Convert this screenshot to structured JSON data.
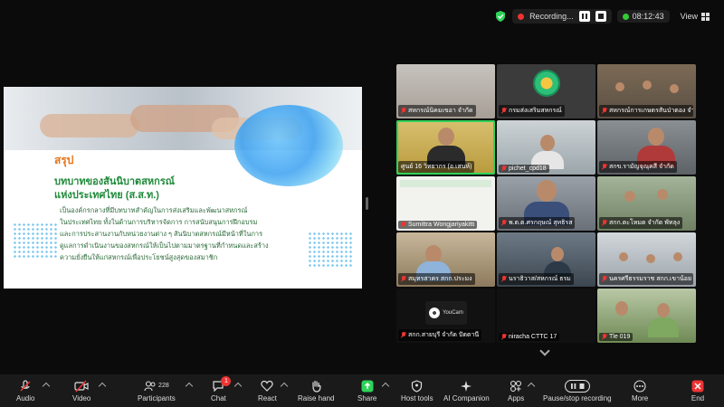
{
  "topbar": {
    "recording_label": "Recording...",
    "time": "08:12:43",
    "view_label": "View"
  },
  "slide": {
    "heading": "สรุป",
    "subtitle_line1": "บทบาทของสันนิบาตสหกรณ์",
    "subtitle_line2": "แห่งประเทศไทย (ส.ส.ท.)",
    "body_lines": [
      "เป็นองค์กรกลางที่มีบทบาทสำคัญในการส่งเสริมและพัฒนาสหกรณ์",
      "ในประเทศไทย ทั้งในด้านการบริหารจัดการ การสนับสนุนการฝึกอบรม",
      "และการประสานงานกับหน่วยงานต่าง ๆ สันนิบาตสหกรณ์มีหน้าที่ในการ",
      "ดูแลการดำเนินงานของสหกรณ์ให้เป็นไปตามมาตรฐานที่กำหนดและสร้าง",
      "ความยั่งยืนให้แก่สหกรณ์เพื่อประโยชน์สูงสุดของสมาชิก"
    ]
  },
  "participants_tiles": [
    {
      "name": "สหกรณ์นิคมเขอา จำกัด"
    },
    {
      "name": "กรมส่งเสริมสหกรณ์"
    },
    {
      "name": "สหกรณ์การเกษตรสันป่าตอง จำก"
    },
    {
      "name": "ศูนย์ 16 วิทยากร (อ.เสนห์)"
    },
    {
      "name": "pichet_cpd18"
    },
    {
      "name": "สกข.รามัญจุณุคสี จำกัด"
    },
    {
      "name": "Sumittra Wongjariyakitti"
    },
    {
      "name": "พ.ต.ต.ศรกฤษณ์ สุทธิรส"
    },
    {
      "name": "สกก.ตะโหมด จำกัด พัทลุง"
    },
    {
      "name": "สมุทรสาคร สกก.ประมง"
    },
    {
      "name": "นราธิวาส/สหกรณ์ ธรม"
    },
    {
      "name": "นครศรีธรรมราช สกก.เขาน้อย"
    },
    {
      "name": "สกก.สายบุรี จำกัด ปัตตานี"
    },
    {
      "name": "niracha CTTC 17"
    },
    {
      "name": "Tle 019"
    }
  ],
  "youcam_label": "YouCam",
  "toolbar": {
    "audio": "Audio",
    "video": "Video",
    "participants": "Participants",
    "participants_count": "228",
    "chat": "Chat",
    "chat_badge": "1",
    "react": "React",
    "raise_hand": "Raise hand",
    "share": "Share",
    "host_tools": "Host tools",
    "ai_companion": "AI Companion",
    "apps": "Apps",
    "pause_stop_recording": "Pause/stop recording",
    "more": "More",
    "end": "End"
  },
  "colors": {
    "accent_green": "#2fd35a",
    "end_red": "#e33333",
    "slide_orange": "#e8751a",
    "slide_green": "#1f8a3a"
  }
}
